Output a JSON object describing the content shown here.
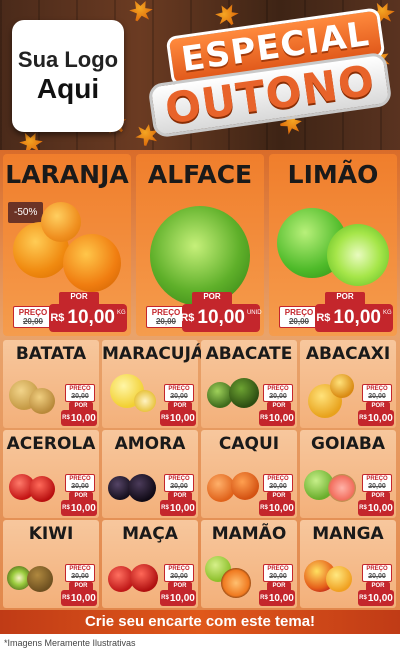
{
  "logo": {
    "line1": "Sua Logo",
    "line2": "Aqui"
  },
  "title": {
    "line1": "ESPECIAL",
    "line2": "OUTONO"
  },
  "featured": [
    {
      "name": "LARANJA",
      "badge": "-50%",
      "preco_label": "PREÇO",
      "old_price": "20,00",
      "por_label": "POR",
      "currency": "R$",
      "price": "10,00",
      "unit": "KG"
    },
    {
      "name": "ALFACE",
      "badge": "",
      "preco_label": "PREÇO",
      "old_price": "20,00",
      "por_label": "POR",
      "currency": "R$",
      "price": "10,00",
      "unit": "UNID"
    },
    {
      "name": "LIMÃO",
      "badge": "",
      "preco_label": "PREÇO",
      "old_price": "20,00",
      "por_label": "POR",
      "currency": "R$",
      "price": "10,00",
      "unit": "KG"
    }
  ],
  "products": [
    {
      "name": "BATATA",
      "preco_label": "PREÇO",
      "old_price": "20,00",
      "por_label": "POR",
      "currency": "R$",
      "price": "10,00"
    },
    {
      "name": "MARACUJÁ",
      "preco_label": "PREÇO",
      "old_price": "20,00",
      "por_label": "POR",
      "currency": "R$",
      "price": "10,00"
    },
    {
      "name": "ABACATE",
      "preco_label": "PREÇO",
      "old_price": "20,00",
      "por_label": "POR",
      "currency": "R$",
      "price": "10,00"
    },
    {
      "name": "ABACAXI",
      "preco_label": "PREÇO",
      "old_price": "20,00",
      "por_label": "POR",
      "currency": "R$",
      "price": "10,00"
    },
    {
      "name": "ACEROLA",
      "preco_label": "PREÇO",
      "old_price": "20,00",
      "por_label": "POR",
      "currency": "R$",
      "price": "10,00"
    },
    {
      "name": "AMORA",
      "preco_label": "PREÇO",
      "old_price": "20,00",
      "por_label": "POR",
      "currency": "R$",
      "price": "10,00"
    },
    {
      "name": "CAQUI",
      "preco_label": "PREÇO",
      "old_price": "20,00",
      "por_label": "POR",
      "currency": "R$",
      "price": "10,00"
    },
    {
      "name": "GOIABA",
      "preco_label": "PREÇO",
      "old_price": "20,00",
      "por_label": "POR",
      "currency": "R$",
      "price": "10,00"
    },
    {
      "name": "KIWI",
      "preco_label": "PREÇO",
      "old_price": "20,00",
      "por_label": "POR",
      "currency": "R$",
      "price": "10,00"
    },
    {
      "name": "MAÇA",
      "preco_label": "PREÇO",
      "old_price": "20,00",
      "por_label": "POR",
      "currency": "R$",
      "price": "10,00"
    },
    {
      "name": "MAMÃO",
      "preco_label": "PREÇO",
      "old_price": "20,00",
      "por_label": "POR",
      "currency": "R$",
      "price": "10,00"
    },
    {
      "name": "MANGA",
      "preco_label": "PREÇO",
      "old_price": "20,00",
      "por_label": "POR",
      "currency": "R$",
      "price": "10,00"
    }
  ],
  "footer": {
    "cta": "Crie seu encarte com este tema!",
    "note": "*Imagens Meramente Ilustrativas"
  },
  "colors": {
    "price_red": "#c4262c",
    "accent_orange": "#e0581a"
  }
}
